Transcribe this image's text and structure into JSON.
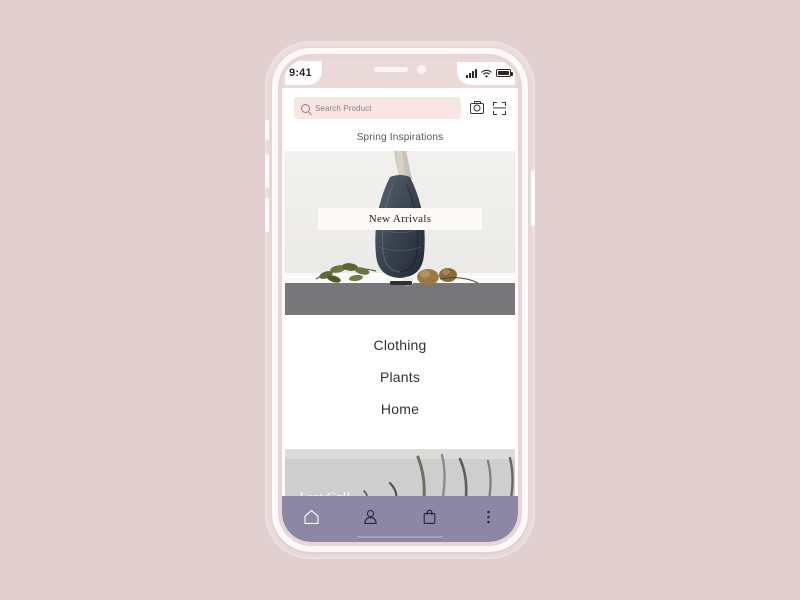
{
  "page": {
    "background_color": "#e2cfcf",
    "device_frame_color": "#fdf9f8"
  },
  "status_bar": {
    "time": "9:41",
    "signal_icon": "cellular-signal-icon",
    "wifi_icon": "wifi-icon",
    "battery_icon": "battery-icon",
    "notch_speaker": "speaker-slot",
    "notch_camera": "front-camera-lens"
  },
  "search": {
    "placeholder": "Search Product",
    "value": "",
    "search_icon": "search-icon",
    "camera_icon": "camera-icon",
    "scan_icon": "barcode-scan-icon",
    "field_color": "#f7e6e4"
  },
  "main": {
    "section_title": "Spring Inspirations",
    "hero": {
      "label": "New Arrivals",
      "alt": "dark mesh tote bag hanging on light wall with olive branches and gold ornaments"
    },
    "categories": [
      {
        "label": "Clothing"
      },
      {
        "label": "Plants"
      },
      {
        "label": "Home"
      }
    ],
    "sale_banner": {
      "label": "Last Call",
      "alt": "tall grass blades against grey background"
    }
  },
  "bottom_nav": {
    "background_color": "#8b87a5",
    "active_color": "#ffffff",
    "inactive_color": "#2b2733",
    "items": [
      {
        "name": "home",
        "icon": "home-icon",
        "active": true
      },
      {
        "name": "account",
        "icon": "person-icon",
        "active": false
      },
      {
        "name": "bag",
        "icon": "shopping-bag-icon",
        "active": false
      },
      {
        "name": "more",
        "icon": "more-vertical-icon",
        "active": false
      }
    ]
  }
}
